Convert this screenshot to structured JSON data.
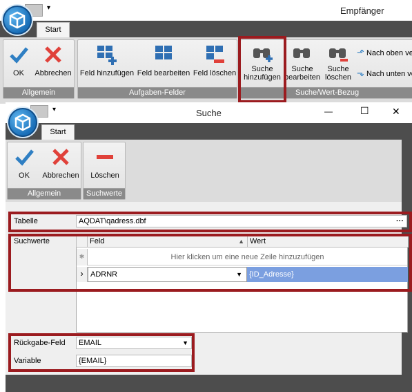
{
  "back_window": {
    "title": "Empfänger",
    "tab_start": "Start",
    "groups": {
      "allgemein": "Allgemein",
      "aufgaben_felder": "Aufgaben-Felder",
      "suche_wert_bezug": "Suche/Wert-Bezug"
    },
    "buttons": {
      "ok": "OK",
      "abbrechen": "Abbrechen",
      "feld_hinzufuegen": "Feld hinzufügen",
      "feld_bearbeiten": "Feld bearbeiten",
      "feld_loeschen": "Feld löschen",
      "suche_hinzufuegen_1": "Suche",
      "suche_hinzufuegen_2": "hinzufügen",
      "suche_bearbeiten_1": "Suche",
      "suche_bearbeiten_2": "bearbeiten",
      "suche_loeschen_1": "Suche",
      "suche_loeschen_2": "löschen",
      "nach_oben": "Nach oben ve",
      "nach_unten": "Nach unten ve"
    },
    "qat_arrow": "▾"
  },
  "dialog": {
    "title": "Suche",
    "tab_start": "Start",
    "window_controls": {
      "minimize": "—",
      "maximize": "☐",
      "close": "✕"
    },
    "groups": {
      "allgemein": "Allgemein",
      "suchwerte": "Suchwerte"
    },
    "buttons": {
      "ok": "OK",
      "abbrechen": "Abbrechen",
      "loeschen": "Löschen"
    },
    "qat_arrow": "▾",
    "form": {
      "tabelle_label": "Tabelle",
      "tabelle_value": "AQDAT\\qadress.dbf",
      "ellipsis": "···",
      "suchwerte_label": "Suchwerte",
      "grid": {
        "col_feld": "Feld",
        "col_wert": "Wert",
        "new_row_hint": "Hier klicken um eine neue Zeile hinzuzufügen",
        "new_row_marker": "✱",
        "row_marker": "›",
        "rows": [
          {
            "feld": "ADRNR",
            "wert": "{ID_Adresse}"
          }
        ]
      },
      "rueckgabe_label": "Rückgabe-Feld",
      "rueckgabe_value": "EMAIL",
      "variable_label": "Variable",
      "variable_value": "{EMAIL}"
    }
  },
  "colors": {
    "highlight_red": "#9b1b1f",
    "ok_blue": "#2f7fc3",
    "cancel_red": "#e0413a",
    "selected_cell": "#7b9fe0"
  }
}
